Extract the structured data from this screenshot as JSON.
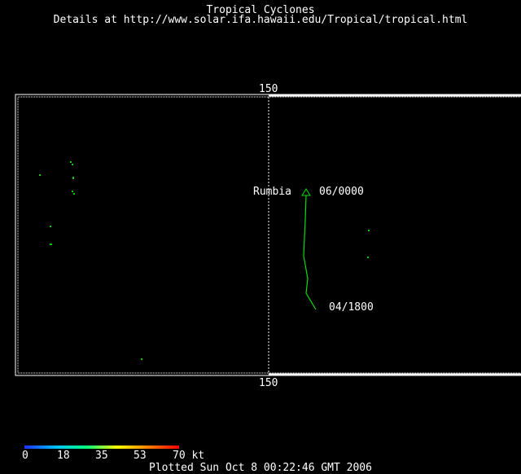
{
  "header": {
    "title": "Tropical Cyclones",
    "subtitle": "Details at http://www.solar.ifa.hawaii.edu/Tropical/tropical.html"
  },
  "map": {
    "lon_label_top": "150",
    "lon_label_bottom": "150",
    "storm": {
      "name": "Rumbia",
      "start_label": "04/1800",
      "end_label": "06/0000",
      "track_color": "#00e000"
    }
  },
  "scale": {
    "ticks": [
      "0",
      "18",
      "35",
      "53",
      "70 kt"
    ],
    "colors": [
      "#2030ff",
      "#00c0ff",
      "#00ff80",
      "#ffff00",
      "#ff8000",
      "#ff0000"
    ]
  },
  "footer": {
    "plotted": "Plotted Sun Oct 8 00:22:46 GMT 2006"
  }
}
